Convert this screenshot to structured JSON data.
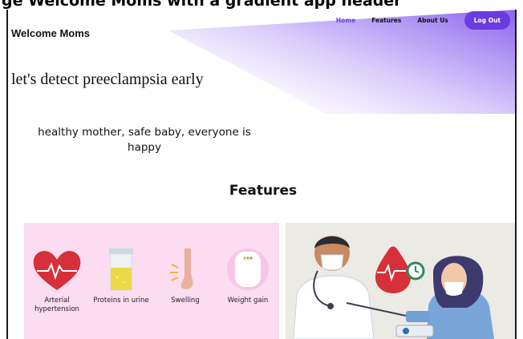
{
  "caption": "ge Welcome Moms with a gradient app header",
  "brand": {
    "title": "Welcome Moms"
  },
  "nav": {
    "items": [
      {
        "label": "Home",
        "active": true
      },
      {
        "label": "Features",
        "active": false
      },
      {
        "label": "About Us",
        "active": false
      }
    ],
    "logout_label": "Log Out"
  },
  "hero": {
    "headline": "let's detect preeclampsia early",
    "tagline": "healthy mother, safe baby, everyone is happy"
  },
  "features": {
    "title": "Features",
    "items": [
      {
        "label": "Arterial hypertension",
        "icon": "heart-pulse-icon"
      },
      {
        "label": "Proteins in urine",
        "icon": "urine-cup-icon"
      },
      {
        "label": "Swelling",
        "icon": "swollen-leg-icon"
      },
      {
        "label": "Weight gain",
        "icon": "scale-icon"
      }
    ]
  },
  "illustration": {
    "name": "doctor-measuring-blood-pressure"
  },
  "colors": {
    "accent": "#6a3be0",
    "panel_pink": "#fbdcf1",
    "heart_red": "#d6303a"
  }
}
